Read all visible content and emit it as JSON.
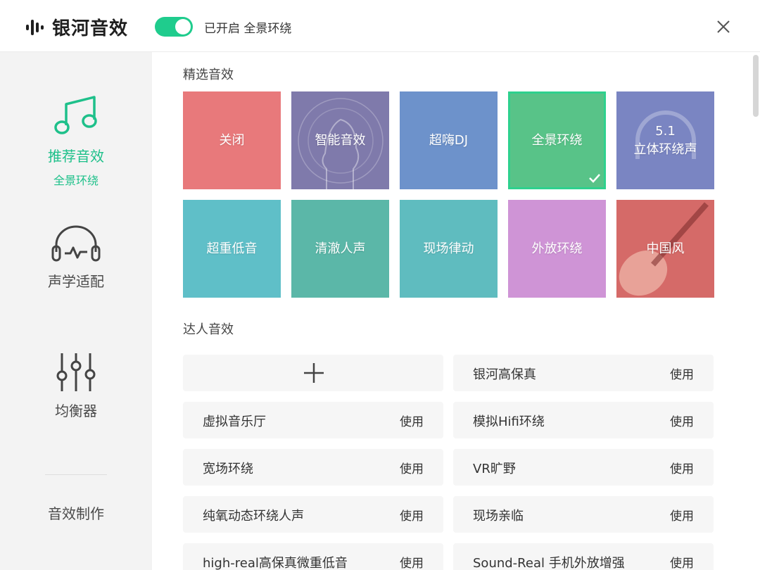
{
  "header": {
    "app_name": "银河音效",
    "status_text": "已开启 全景环绕",
    "toggle_on": true
  },
  "sidebar": {
    "items": [
      {
        "label": "推荐音效",
        "sub": "全景环绕",
        "active": true,
        "icon": "music-note-icon"
      },
      {
        "label": "声学适配",
        "active": false,
        "icon": "headphones-icon"
      },
      {
        "label": "均衡器",
        "active": false,
        "icon": "equalizer-icon"
      }
    ],
    "maker": "音效制作"
  },
  "featured": {
    "title": "精选音效",
    "tiles": [
      {
        "label": "关闭",
        "color": "#e8797b"
      },
      {
        "label": "智能音效",
        "color": "#7f7aab"
      },
      {
        "label": "超嗨DJ",
        "color": "#6d92cb"
      },
      {
        "label": "全景环绕",
        "color": "#58c388",
        "selected": true
      },
      {
        "label": "5.1",
        "label2": "立体环绕声",
        "color": "#7a85c2"
      },
      {
        "label": "超重低音",
        "color": "#5fbfc8"
      },
      {
        "label": "清澈人声",
        "color": "#5bb7a8"
      },
      {
        "label": "现场律动",
        "color": "#5fbcbf"
      },
      {
        "label": "外放环绕",
        "color": "#cf94d6"
      },
      {
        "label": "中国风",
        "color": "#d56a68"
      }
    ]
  },
  "expert": {
    "title": "达人音效",
    "use_label": "使用",
    "cards": [
      "银河高保真",
      "虚拟音乐厅",
      "模拟Hifi环绕",
      "宽场环绕",
      "VR旷野",
      "纯氧动态环绕人声",
      "现场亲临",
      "high-real高保真微重低音",
      "Sound-Real 手机外放增强"
    ]
  }
}
